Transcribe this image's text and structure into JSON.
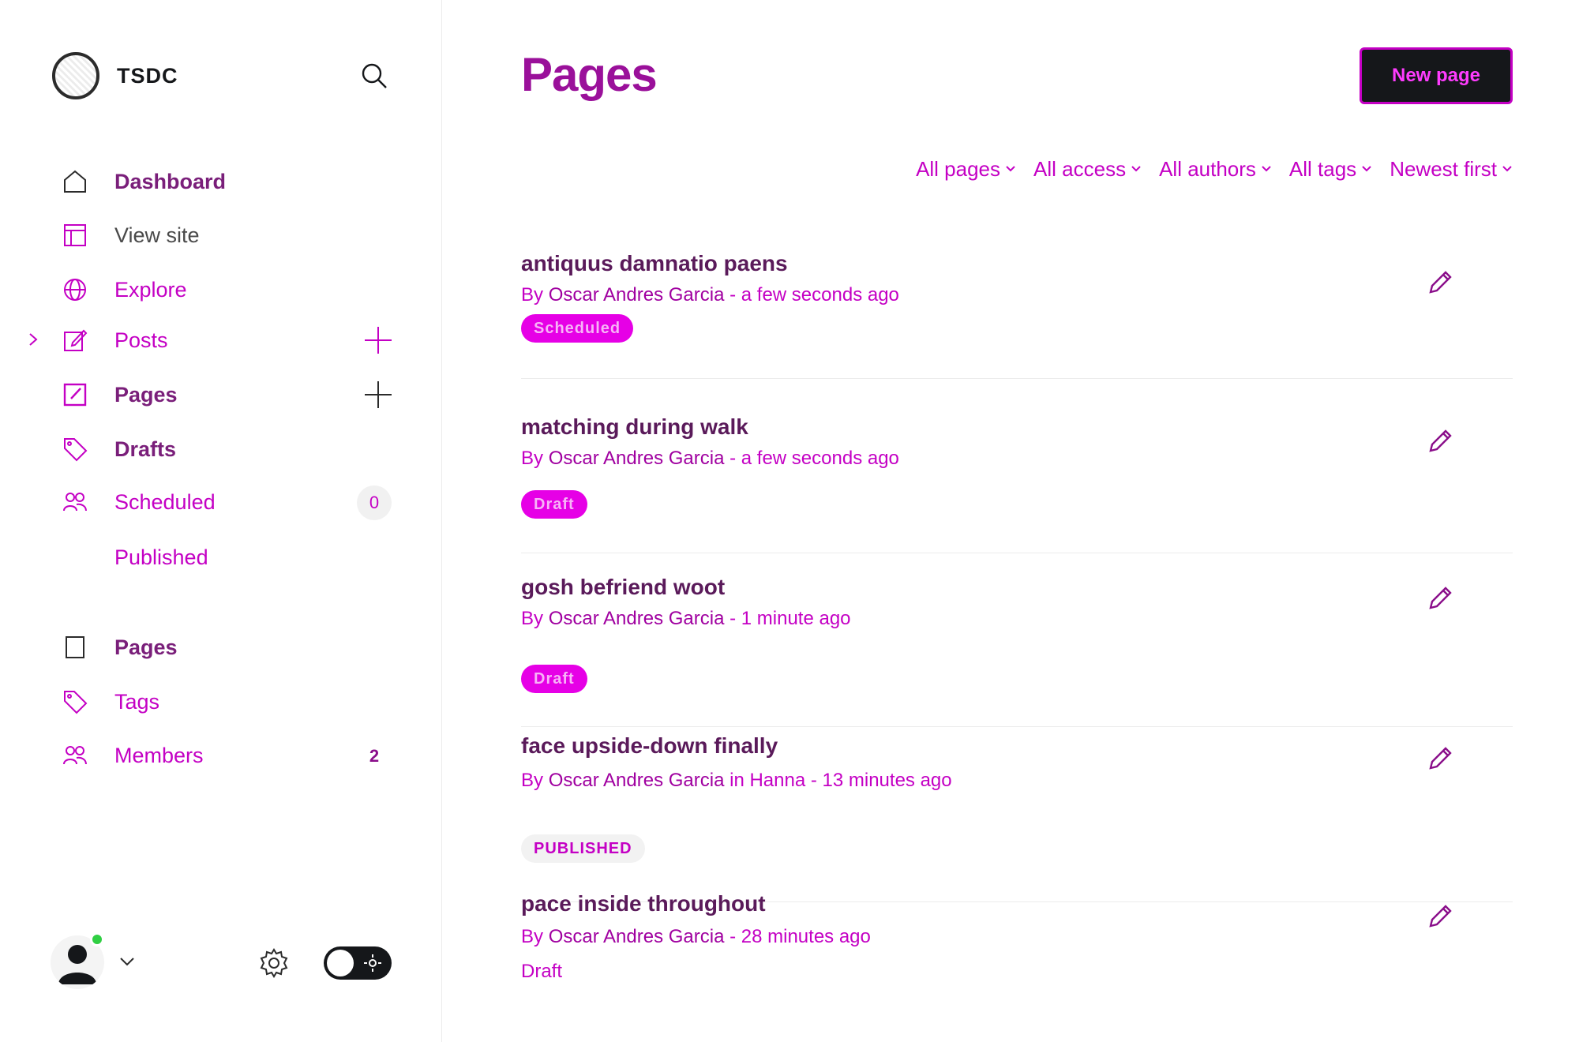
{
  "sidebar": {
    "brand": "TSDC",
    "nav_primary": [
      {
        "label": "Dashboard"
      },
      {
        "label": "View site"
      },
      {
        "label": "Explore"
      },
      {
        "label": "Posts"
      },
      {
        "label": "Pages"
      },
      {
        "label": "Drafts"
      },
      {
        "label": "Scheduled",
        "count": "0"
      },
      {
        "label": "Published"
      }
    ],
    "nav_secondary": [
      {
        "label": "Pages"
      },
      {
        "label": "Tags"
      },
      {
        "label": "Members",
        "count": "2"
      }
    ]
  },
  "main": {
    "title": "Pages",
    "new_button": "New page",
    "filters": [
      "All pages",
      "All access",
      "All authors",
      "All tags",
      "Newest first"
    ],
    "rows": [
      {
        "title": "antiquus damnatio paens",
        "author": "Oscar Andres Garcia",
        "time": "a few seconds ago",
        "status": "Scheduled"
      },
      {
        "title": "matching during walk",
        "author": "Oscar Andres Garcia",
        "time": "a few seconds ago",
        "status": "Draft"
      },
      {
        "title": "gosh befriend woot",
        "author": "Oscar Andres Garcia",
        "time": "1 minute ago",
        "status": "Draft"
      },
      {
        "title": "face upside-down finally",
        "author": "Oscar Andres Garcia",
        "tag": "Hanna",
        "time": "13 minutes ago",
        "status": "PUBLISHED"
      },
      {
        "title": "pace inside throughout",
        "author": "Oscar Andres Garcia",
        "time": "28 minutes ago",
        "status": "Draft"
      }
    ]
  },
  "colors": {
    "accent": "#c400c4",
    "dark": "#15171a",
    "online": "#30cf43"
  }
}
